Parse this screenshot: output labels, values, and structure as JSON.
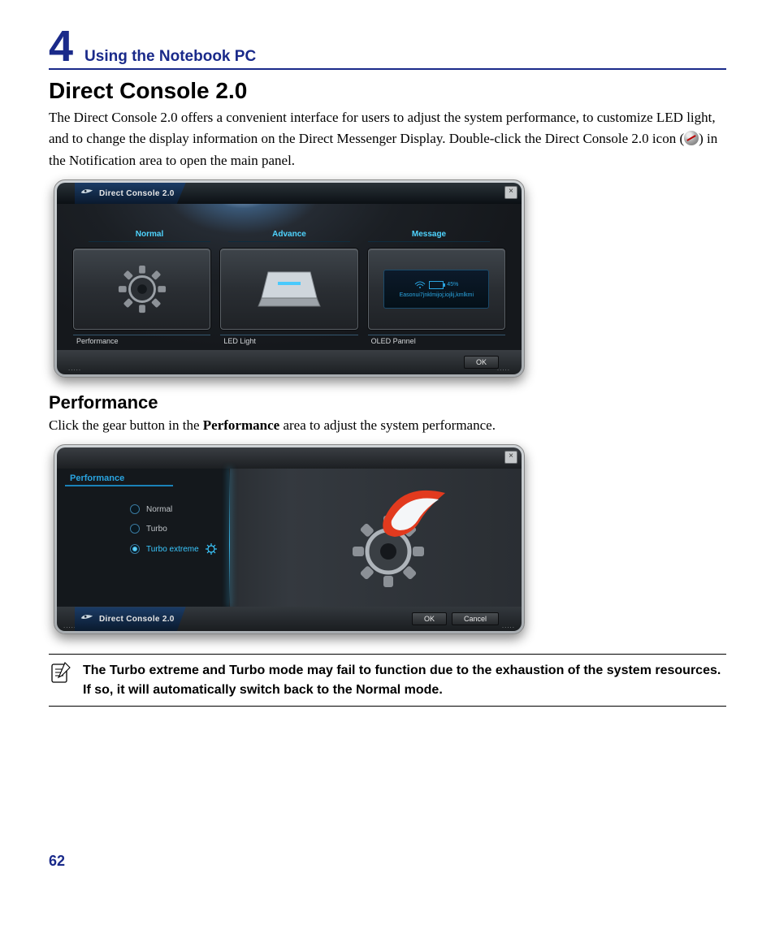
{
  "chapter": {
    "num": "4",
    "title": "Using the Notebook PC"
  },
  "section_title": "Direct Console 2.0",
  "intro_a": "The Direct Console 2.0 offers a convenient interface for users to adjust the system performance, to customize LED light, and to change the display information on the Direct Messenger Display. Double-click the Direct Console 2.0 icon (",
  "intro_b": ") in the Notification area to open the main panel.",
  "app1": {
    "title": "Direct Console 2.0",
    "close": "×",
    "modes": [
      "Normal",
      "Advance",
      "Message"
    ],
    "categories": [
      "Performance",
      "LED Light",
      "OLED Pannel"
    ],
    "oled_pct": "45%",
    "oled_text": "Easonui7jnklmijoj;iojlij,kmlkmi",
    "ok": "OK"
  },
  "subsection_title": "Performance",
  "perf_text_a": "Click the gear button in the ",
  "perf_text_bold": "Performance",
  "perf_text_b": " area to adjust the system performance.",
  "app2": {
    "tab": "Performance",
    "options": [
      "Normal",
      "Turbo",
      "Turbo extreme"
    ],
    "selected_index": 2,
    "brand": "Direct Console 2.0",
    "ok": "OK",
    "cancel": "Cancel"
  },
  "note": "The Turbo extreme and Turbo mode may fail to function due to the exhaustion of the system resources. If so, it will automatically switch back to the Normal mode.",
  "page_num": "62"
}
